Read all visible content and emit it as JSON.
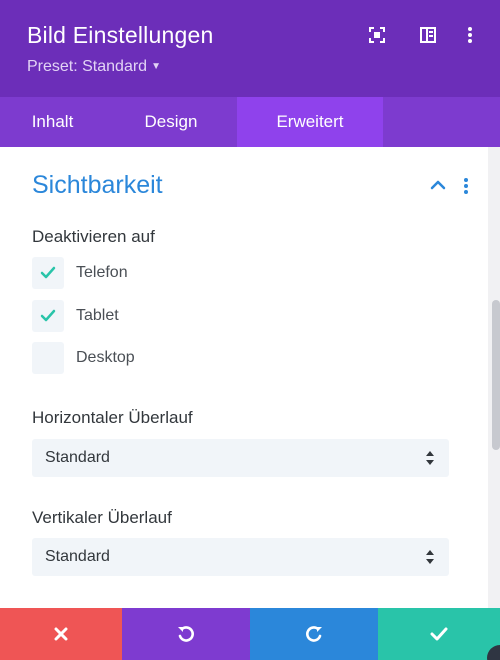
{
  "header": {
    "title": "Bild Einstellungen",
    "preset_label": "Preset: Standard",
    "icons": [
      "expand-icon",
      "sidebar-layout-icon",
      "more-vertical-icon"
    ],
    "bg_color": "#6c2eb9"
  },
  "tabs": [
    {
      "label": "Inhalt",
      "active": false
    },
    {
      "label": "Design",
      "active": false
    },
    {
      "label": "Erweitert",
      "active": true
    }
  ],
  "section": {
    "title": "Sichtbarkeit",
    "title_color": "#2b87da",
    "disable_on": {
      "label": "Deaktivieren auf",
      "options": [
        {
          "label": "Telefon",
          "checked": true
        },
        {
          "label": "Tablet",
          "checked": true
        },
        {
          "label": "Desktop",
          "checked": false
        }
      ]
    },
    "overflow_x": {
      "label": "Horizontaler Überlauf",
      "value": "Standard"
    },
    "overflow_y": {
      "label": "Vertikaler Überlauf",
      "value": "Standard"
    }
  },
  "footer": {
    "buttons": [
      {
        "name": "cancel",
        "icon": "close-icon",
        "color": "#ef5555"
      },
      {
        "name": "undo",
        "icon": "undo-icon",
        "color": "#7e3bd0"
      },
      {
        "name": "redo",
        "icon": "redo-icon",
        "color": "#2b87da"
      },
      {
        "name": "save",
        "icon": "check-icon",
        "color": "#29c4a9"
      }
    ]
  }
}
